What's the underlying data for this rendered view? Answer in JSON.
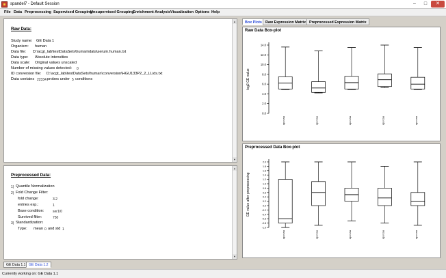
{
  "window": {
    "title": "spandel7 - Default Session"
  },
  "menu": [
    "File",
    "Data",
    "Preprocessing",
    "Supervised Grouping",
    "Unsupervised Grouping",
    "Enrichment Analysis",
    "Visualization",
    "Options",
    "Help"
  ],
  "raw": {
    "heading": "Raw Data:",
    "study_label": "Study name:",
    "study_value": "GE Data 1",
    "organism_label": "Organism:",
    "organism_value": "human",
    "file_label": "Data file:",
    "file_value": "D:\\acgt_lab\\testDataSets\\human\\data\\serum.human.txt",
    "type_label": "Data type:",
    "type_value": "Absolute intensities",
    "scale_label": "Data scale:",
    "scale_value": "Original values unscaled",
    "missing_label": "Number of missing values detected:",
    "missing_value": "0",
    "idconv_label": "ID conversion file:",
    "idconv_value": "D:\\acgt_lab\\testDataSets\\human\\conversion\\HGU133P2_2_LLids.txt",
    "contains_label": "Data contains",
    "contains_probes": "22334",
    "contains_mid": "probes under",
    "contains_conds": "5",
    "contains_tail": "conditions"
  },
  "pre": {
    "heading": "Preprocessed Data:",
    "step1_num": "1)",
    "step1_label": "Quantile Normalization",
    "step2_num": "2)",
    "step2_label": "Fold Change Filter:",
    "fold_label": "fold change:",
    "fold_value": "3.2",
    "entries_label": "entries exp.:",
    "entries_value": "1",
    "base_label": "Base condition:",
    "base_value": "ser1/0",
    "survived_label": "Survived filter:",
    "survived_value": "750",
    "step3_num": "3)",
    "step3_label": "Standardization:",
    "type_label": "Type:",
    "type_mean": "mean",
    "type_mean_val": "0",
    "type_and": "and std",
    "type_std_val": "1"
  },
  "bottom_tabs": [
    "GE Data 1.1",
    "GE Data 1.2"
  ],
  "status": "Currently working on: GE Data 1.1",
  "tabs": [
    "Box Plots",
    "Raw Expression Matrix",
    "Preprocessed Expression Matrix"
  ],
  "colors": {
    "accent_tab": "#2a4ad8",
    "close_button": "#c94a3f",
    "app_icon": "#c0392b"
  },
  "chart_data": [
    {
      "type": "boxplot",
      "title": "Raw Data Box-plot",
      "ylabel": "log2 GE value",
      "ylim": [
        0.0,
        14.0
      ],
      "yticks": [
        "0.0",
        "2.0",
        "4.0",
        "6.0",
        "8.0",
        "10.0",
        "12.0",
        "14.0"
      ],
      "categories": [
        "sample_1",
        "sample_2",
        "sample_3",
        "sample_4",
        "sample_5"
      ],
      "category_labels": [
        "xp.rcau",
        "xp.rcau",
        "xp.rcau",
        "xp.rcau",
        "xp.rcau"
      ],
      "boxes": [
        {
          "min": 4.9,
          "q1": 5.0,
          "median": 6.2,
          "q3": 7.5,
          "max": 13.6
        },
        {
          "min": 4.2,
          "q1": 4.3,
          "median": 5.2,
          "q3": 6.5,
          "max": 12.8
        },
        {
          "min": 4.9,
          "q1": 5.0,
          "median": 6.3,
          "q3": 7.6,
          "max": 13.5
        },
        {
          "min": 5.3,
          "q1": 5.5,
          "median": 6.9,
          "q3": 8.1,
          "max": 14.0
        },
        {
          "min": 4.9,
          "q1": 5.0,
          "median": 6.0,
          "q3": 7.4,
          "max": 13.5
        }
      ]
    },
    {
      "type": "boxplot",
      "title": "Preprocessed Data Box-plot",
      "ylabel": "GE value after preprocessing",
      "ylim": [
        -1.0,
        2.0
      ],
      "yticks": [
        "-1.0",
        "-0.8",
        "-0.6",
        "-0.4",
        "-0.2",
        "0.0",
        "0.2",
        "0.4",
        "0.6",
        "0.8",
        "1.0",
        "1.2",
        "1.4",
        "1.6",
        "1.8",
        "2.0"
      ],
      "categories": [
        "sample_1",
        "sample_2",
        "sample_3",
        "sample_4",
        "sample_5"
      ],
      "category_labels": [
        "xp.rcau",
        "xp.rcau",
        "xp.rcau",
        "xp.rcau",
        "xp.rcau"
      ],
      "boxes": [
        {
          "min": -1.0,
          "q1": -0.8,
          "median": -0.6,
          "q3": 1.2,
          "max": 2.0
        },
        {
          "min": -0.9,
          "q1": 0.0,
          "median": 0.6,
          "q3": 1.1,
          "max": 2.0
        },
        {
          "min": -0.7,
          "q1": 0.2,
          "median": 0.5,
          "q3": 0.8,
          "max": 2.0
        },
        {
          "min": -0.8,
          "q1": 0.0,
          "median": 0.35,
          "q3": 0.8,
          "max": 1.8
        },
        {
          "min": -0.9,
          "q1": 0.0,
          "median": 0.2,
          "q3": 0.6,
          "max": 2.0
        }
      ]
    }
  ]
}
